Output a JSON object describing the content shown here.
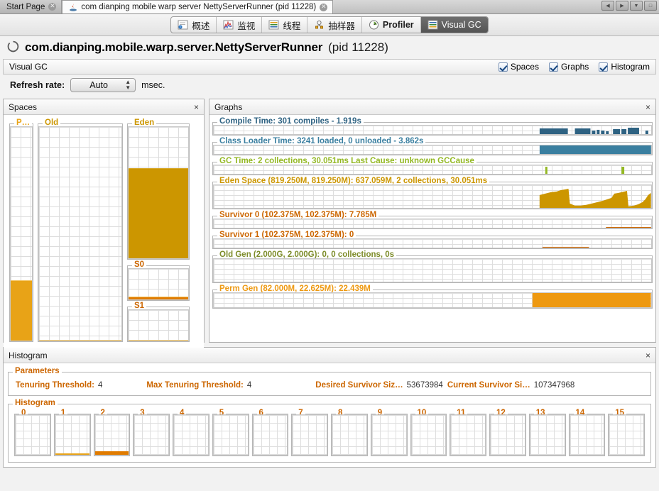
{
  "window": {
    "tabs": [
      {
        "label": "Start Page",
        "active": false,
        "icon": "none"
      },
      {
        "label": "com dianping mobile warp server NettyServerRunner (pid 11228)",
        "active": true,
        "icon": "java-icon"
      }
    ],
    "controls": [
      "prev-arrow",
      "next-arrow",
      "dropdown-arrow",
      "maximize"
    ]
  },
  "view_tabs": [
    {
      "label": "概述",
      "icon": "overview-icon",
      "selected": false
    },
    {
      "label": "监视",
      "icon": "monitor-icon",
      "selected": false
    },
    {
      "label": "线程",
      "icon": "threads-icon",
      "selected": false
    },
    {
      "label": "抽样器",
      "icon": "sampler-icon",
      "selected": false
    },
    {
      "label": "Profiler",
      "icon": "profiler-icon",
      "selected": false
    },
    {
      "label": "Visual GC",
      "icon": "visualgc-icon",
      "selected": true
    }
  ],
  "header": {
    "app_name": "com.dianping.mobile.warp.server.NettyServerRunner",
    "pid_text": "(pid 11228)",
    "status_icon": "loading-spinner-icon"
  },
  "visual_gc": {
    "title": "Visual GC",
    "checkboxes": [
      {
        "label": "Spaces",
        "checked": true
      },
      {
        "label": "Graphs",
        "checked": true
      },
      {
        "label": "Histogram",
        "checked": true
      }
    ]
  },
  "refresh": {
    "label": "Refresh rate:",
    "value": "Auto",
    "unit": "msec."
  },
  "spaces": {
    "title": "Spaces",
    "close": "×",
    "meters": [
      {
        "name": "perm",
        "label": "P…",
        "fill_pct": 28,
        "style": "bright"
      },
      {
        "name": "old",
        "label": "Old",
        "fill_pct": 0,
        "style": "bright"
      },
      {
        "name": "eden",
        "label": "Eden",
        "fill_pct": 68,
        "style": "dark"
      },
      {
        "name": "s0",
        "label": "S0",
        "fill_pct": 5,
        "style": "line"
      },
      {
        "name": "s1",
        "label": "S1",
        "fill_pct": 0,
        "style": "line"
      }
    ]
  },
  "graphs": {
    "title": "Graphs",
    "close": "×",
    "items": [
      {
        "name": "compile-time",
        "label": "Compile Time: 301 compiles - 1.919s",
        "color": "#2e6282"
      },
      {
        "name": "class-loader-time",
        "label": "Class Loader Time: 3241 loaded, 0 unloaded - 3.862s",
        "color": "#3a7fa0"
      },
      {
        "name": "gc-time",
        "label": "GC Time: 2 collections, 30.051ms Last Cause: unknown GCCause",
        "color": "#93b823"
      },
      {
        "name": "eden-space",
        "label": "Eden Space (819.250M, 819.250M): 637.059M, 2 collections, 30.051ms",
        "color": "#cc9600"
      },
      {
        "name": "survivor-0",
        "label": "Survivor 0 (102.375M, 102.375M): 7.785M",
        "color": "#cc6600"
      },
      {
        "name": "survivor-1",
        "label": "Survivor 1 (102.375M, 102.375M): 0",
        "color": "#cc6600"
      },
      {
        "name": "old-gen",
        "label": "Old Gen (2.000G, 2.000G): 0, 0 collections, 0s",
        "color": "#7d8c2a"
      },
      {
        "name": "perm-gen",
        "label": "Perm Gen (82.000M, 22.625M): 22.439M",
        "color": "#ee9911"
      }
    ]
  },
  "histogram_panel": {
    "title": "Histogram",
    "close": "×",
    "parameters": {
      "group_label": "Parameters",
      "items": [
        {
          "key": "Tenuring Threshold:",
          "value": "4"
        },
        {
          "key": "Max Tenuring Threshold:",
          "value": "4"
        },
        {
          "key": "Desired Survivor Siz…",
          "value": "53673984"
        },
        {
          "key": "Current Survivor Si…",
          "value": "107347968"
        }
      ]
    },
    "histogram": {
      "group_label": "Histogram",
      "cells": [
        {
          "label": "0",
          "bar_pct": 0
        },
        {
          "label": "1",
          "bar_pct": 3
        },
        {
          "label": "2",
          "bar_pct": 8
        },
        {
          "label": "3",
          "bar_pct": 0
        },
        {
          "label": "4",
          "bar_pct": 0
        },
        {
          "label": "5",
          "bar_pct": 0
        },
        {
          "label": "6",
          "bar_pct": 0
        },
        {
          "label": "7",
          "bar_pct": 0
        },
        {
          "label": "8",
          "bar_pct": 0
        },
        {
          "label": "9",
          "bar_pct": 0
        },
        {
          "label": "10",
          "bar_pct": 0
        },
        {
          "label": "11",
          "bar_pct": 0
        },
        {
          "label": "12",
          "bar_pct": 0
        },
        {
          "label": "13",
          "bar_pct": 0
        },
        {
          "label": "14",
          "bar_pct": 0
        },
        {
          "label": "15",
          "bar_pct": 0
        }
      ]
    }
  },
  "chart_data": [
    {
      "type": "bar",
      "name": "compile-time",
      "title": "Compile Time: 301 compiles - 1.919s",
      "color": "#2e6282",
      "ylim": [
        0,
        1
      ],
      "values": [
        0,
        0,
        0,
        0,
        0,
        0,
        0,
        0,
        0,
        0,
        0,
        0,
        0,
        0,
        0,
        0,
        0,
        0,
        0,
        0,
        0,
        0,
        0,
        0,
        0,
        0,
        0,
        0,
        0,
        0,
        0,
        0,
        0,
        0,
        0.9,
        0.95,
        0.92,
        0.88,
        0.9,
        0,
        0,
        0.55,
        0.9,
        0.6,
        0.45,
        0.55,
        0.5,
        0.4,
        0,
        0,
        0.5,
        0.55,
        0.45,
        0.8,
        0.9,
        0.85,
        0,
        0,
        0.35,
        0.4,
        0,
        0,
        0,
        0.4,
        0.45,
        0.4,
        0.38
      ]
    },
    {
      "type": "bar",
      "name": "class-loader-time",
      "title": "Class Loader Time: 3241 loaded, 0 unloaded - 3.862s",
      "color": "#3a7fa0",
      "ylim": [
        0,
        1
      ],
      "values": [
        0,
        0,
        0,
        0,
        0,
        0,
        0,
        0,
        0,
        0,
        0,
        0,
        0,
        0,
        0,
        0,
        0,
        0,
        0,
        0,
        0,
        0,
        0,
        0,
        0,
        0,
        0,
        0,
        0,
        0,
        0,
        0,
        0,
        0,
        1,
        1,
        1,
        1,
        1,
        1,
        1,
        1,
        1,
        1,
        1,
        1,
        1,
        1,
        1,
        1,
        1,
        1,
        1,
        1,
        1,
        1,
        1,
        1,
        1,
        1,
        1,
        1,
        1,
        1,
        1,
        1,
        1
      ]
    },
    {
      "type": "bar",
      "name": "gc-time",
      "title": "GC Time: 2 collections, 30.051ms Last Cause: unknown GCCause",
      "color": "#93b823",
      "ylim": [
        0,
        1
      ],
      "spikes_at": [
        0.745,
        0.845
      ],
      "values": []
    },
    {
      "type": "area",
      "name": "eden-space",
      "title": "Eden Space (819.250M, 819.250M): 637.059M, 2 collections, 30.051ms",
      "color": "#cc9600",
      "ylim": [
        0,
        819.25
      ],
      "current": 637.059,
      "values": [
        0,
        0,
        0,
        0,
        0,
        0,
        0,
        0,
        0,
        0,
        0,
        0,
        0,
        0,
        0,
        0,
        0,
        0,
        0,
        0,
        0,
        0,
        0,
        0,
        0,
        0,
        0,
        0,
        0,
        0,
        0,
        0,
        0,
        0,
        0,
        0,
        0,
        0,
        560,
        600,
        640,
        660,
        680,
        700,
        720,
        95,
        110,
        130,
        160,
        190,
        215,
        240,
        265,
        290,
        310,
        480,
        500,
        520,
        540,
        560,
        600,
        640,
        60,
        90,
        120,
        150,
        180,
        210,
        240,
        270,
        300,
        340,
        400,
        480,
        560,
        620,
        700
      ]
    },
    {
      "type": "line",
      "name": "survivor-0",
      "title": "Survivor 0 (102.375M, 102.375M): 7.785M",
      "color": "#cc6600",
      "ylim": [
        0,
        102.375
      ],
      "current": 7.785
    },
    {
      "type": "line",
      "name": "survivor-1",
      "title": "Survivor 1 (102.375M, 102.375M): 0",
      "color": "#cc6600",
      "ylim": [
        0,
        102.375
      ],
      "current": 0
    },
    {
      "type": "area",
      "name": "old-gen",
      "title": "Old Gen (2.000G, 2.000G): 0, 0 collections, 0s",
      "color": "#7d8c2a",
      "ylim": [
        0,
        2048
      ],
      "current": 0,
      "values": []
    },
    {
      "type": "area",
      "name": "perm-gen",
      "title": "Perm Gen (82.000M, 22.625M): 22.439M",
      "color": "#ee9911",
      "ylim": [
        0,
        22.625
      ],
      "current": 22.439,
      "fill_from_pct": 73
    }
  ]
}
